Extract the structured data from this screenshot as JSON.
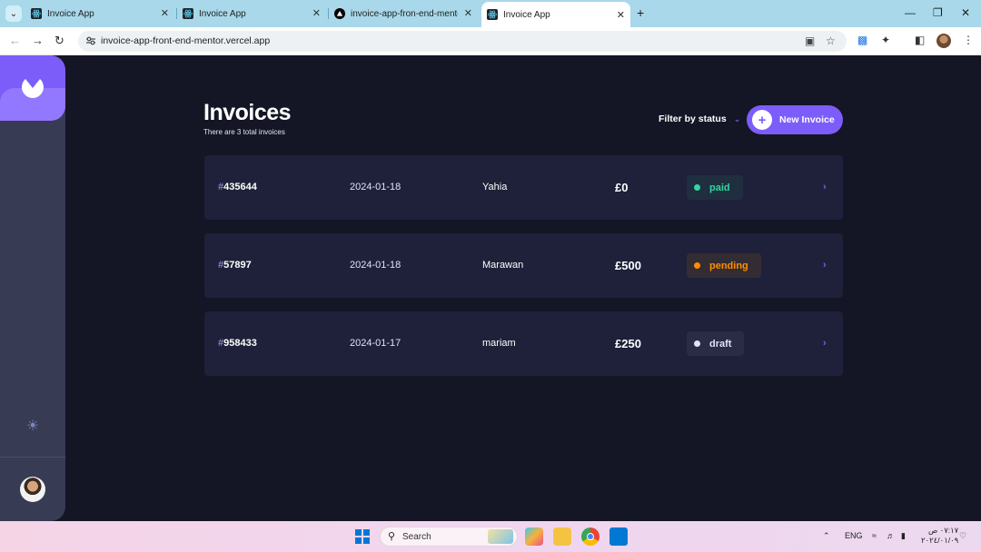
{
  "browser": {
    "tabs": [
      {
        "title": "Invoice App",
        "favicon": "react-icon",
        "active": false
      },
      {
        "title": "Invoice App",
        "favicon": "react-icon",
        "active": false
      },
      {
        "title": "invoice-app-fron-end-mentor",
        "favicon": "vercel-icon",
        "active": false
      },
      {
        "title": "Invoice App",
        "favicon": "react-icon",
        "active": true
      }
    ],
    "url": "invoice-app-front-end-mentor.vercel.app"
  },
  "app": {
    "title": "Invoices",
    "subtitle": "There are 3 total invoices",
    "filter_label": "Filter by status",
    "new_invoice_label": "New Invoice",
    "colors": {
      "accent": "#7c5dfa",
      "paid": "#33d69f",
      "pending": "#ff8f00",
      "draft": "#dfe3fa"
    },
    "invoices": [
      {
        "hash": "#",
        "id": "435644",
        "date": "2024-01-18",
        "client": "Yahia",
        "amount": "£0",
        "status": "paid"
      },
      {
        "hash": "#",
        "id": "57897",
        "date": "2024-01-18",
        "client": "Marawan",
        "amount": "£500",
        "status": "pending"
      },
      {
        "hash": "#",
        "id": "958433",
        "date": "2024-01-17",
        "client": "mariam",
        "amount": "£250",
        "status": "draft"
      }
    ]
  },
  "taskbar": {
    "search_label": "Search",
    "language": "ENG",
    "time": "٠٧:١٧ ص",
    "date": "٢٠٢٤/٠١/٠٩"
  }
}
